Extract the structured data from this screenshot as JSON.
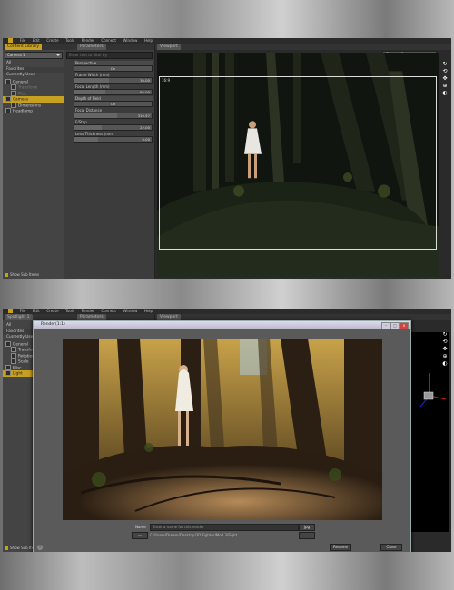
{
  "menu": [
    "File",
    "Edit",
    "Create",
    "Tools",
    "Render",
    "Connect",
    "Window",
    "Help"
  ],
  "shot1": {
    "left_tab": "Content Library",
    "camera_dropdown": "Camera 1",
    "list": [
      "All",
      "Favorites",
      "Currently Used"
    ],
    "tree": [
      "General",
      "Dimensions",
      "Headlamp"
    ],
    "tree_selected": "Camera",
    "dim_items": [
      "Transform",
      "Misc"
    ],
    "show_sub_items": "Show Sub Items",
    "params_tab": "Parameters",
    "search_placeholder": "Enter text to filter by",
    "params": [
      {
        "label": "Perspective",
        "value": "On",
        "type": "toggle"
      },
      {
        "label": "Frame Width (mm)",
        "value": "36.00"
      },
      {
        "label": "Focal Length (mm)",
        "value": "65.00"
      },
      {
        "label": "Depth of Field",
        "value": "On",
        "type": "toggle"
      },
      {
        "label": "Focal Distance",
        "value": "310.57"
      },
      {
        "label": "F/Stop",
        "value": "22.00"
      },
      {
        "label": "Lens Thickness (mm)",
        "value": "0.00"
      }
    ],
    "viewport_tab": "Viewport",
    "viewport_camera": "Camera 1",
    "frame_label": "16:9"
  },
  "shot2": {
    "left_tab": "Spotlight 1",
    "list": [
      "All",
      "Favorites",
      "Currently Used"
    ],
    "tree": [
      "General",
      "Transform",
      "Rotation",
      "Scale",
      "Misc"
    ],
    "tree_selected": "Light",
    "show_sub_items": "Show Sub Items",
    "params_tab": "Parameters",
    "viewport_tab": "Viewport",
    "render_title": "Render(1:1)",
    "name_label": "Name",
    "name_placeholder": "Enter a name for this render",
    "format": "jpg",
    "path": "C:/Users/Dream/Desktop/3D Fighter/Mod 3/Fight",
    "resume_button": "Resume",
    "close_button": "Close",
    "help": "?"
  }
}
